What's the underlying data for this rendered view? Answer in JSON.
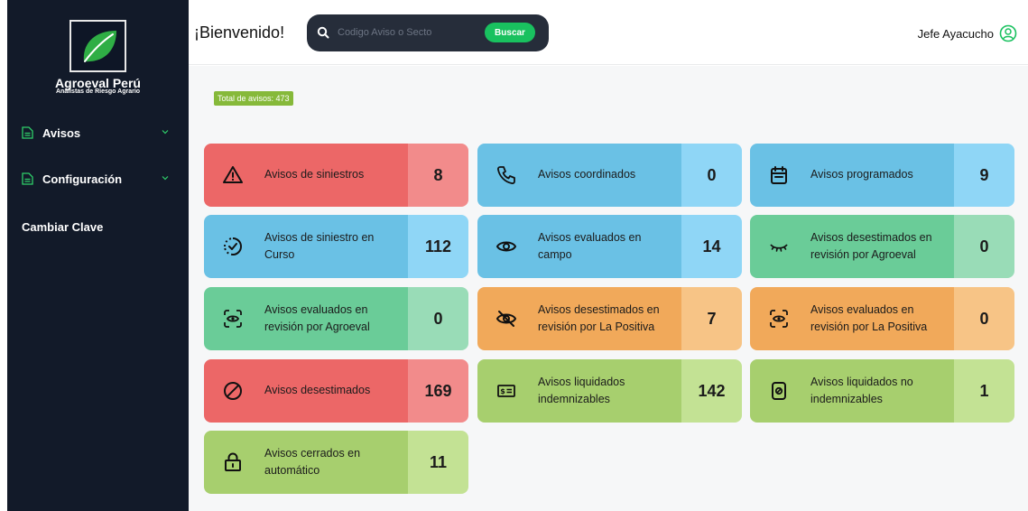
{
  "sidebar": {
    "brand_name": "Agroeval Perú",
    "brand_subtitle": "Analistas de Riesgo Agrario",
    "items": [
      {
        "label": "Avisos"
      },
      {
        "label": "Configuración"
      },
      {
        "label": "Cambiar Clave"
      }
    ]
  },
  "header": {
    "welcome": "¡Bienvenido!",
    "search_placeholder": "Codigo Aviso o Secto",
    "search_button": "Buscar",
    "user_name": "Jefe Ayacucho"
  },
  "main": {
    "total_label": "Total de avisos: 473",
    "cards": [
      {
        "label": "Avisos de siniestros",
        "count": "8",
        "color": "red",
        "icon": "warning-icon"
      },
      {
        "label": "Avisos coordinados",
        "count": "0",
        "color": "blue",
        "icon": "phone-icon"
      },
      {
        "label": "Avisos programados",
        "count": "9",
        "color": "blue",
        "icon": "calendar-icon"
      },
      {
        "label": "Avisos de siniestro en Curso",
        "count": "112",
        "color": "blue",
        "icon": "progress-check-icon"
      },
      {
        "label": "Avisos evaluados en campo",
        "count": "14",
        "color": "blue",
        "icon": "eye-icon"
      },
      {
        "label": "Avisos desestimados en revisión por Agroeval",
        "count": "0",
        "color": "teal",
        "icon": "eye-closed-icon"
      },
      {
        "label": "Avisos evaluados en revisión por Agroeval",
        "count": "0",
        "color": "teal",
        "icon": "scan-eye-icon"
      },
      {
        "label": "Avisos desestimados en revisión por La Positiva",
        "count": "7",
        "color": "orange",
        "icon": "eye-off-icon"
      },
      {
        "label": "Avisos evaluados en revisión por La Positiva",
        "count": "0",
        "color": "orange",
        "icon": "scan-eye-icon"
      },
      {
        "label": "Avisos desestimados",
        "count": "169",
        "color": "red",
        "icon": "ban-icon"
      },
      {
        "label": "Avisos liquidados indemnizables",
        "count": "142",
        "color": "lime",
        "icon": "money-icon"
      },
      {
        "label": "Avisos liquidados no indemnizables",
        "count": "1",
        "color": "lime",
        "icon": "receipt-icon"
      },
      {
        "label": "Avisos cerrados en automático",
        "count": "11",
        "color": "lime",
        "icon": "lock-icon"
      }
    ]
  },
  "colors": {
    "sidebar_bg": "#121a29",
    "accent_green": "#19c15f",
    "badge_green": "#86b93a",
    "red": "#ec6767",
    "blue": "#6ac1e5",
    "teal": "#6acc98",
    "orange": "#f1a95a",
    "lime": "#a7cf6e"
  }
}
